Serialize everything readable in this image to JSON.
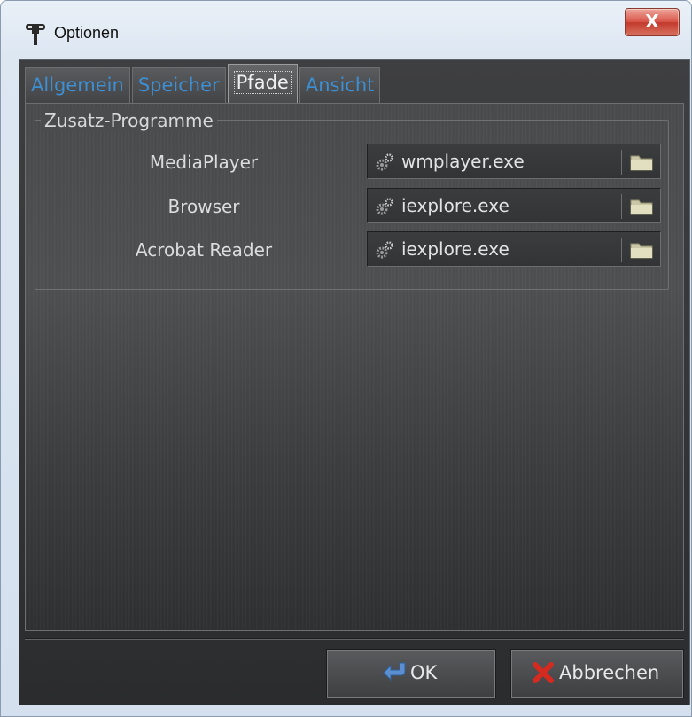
{
  "window": {
    "title": "Optionen",
    "close_label": "X"
  },
  "tabs": [
    {
      "label": "Allgemein",
      "active": false
    },
    {
      "label": "Speicher",
      "active": false
    },
    {
      "label": "Pfade",
      "active": true
    },
    {
      "label": "Ansicht",
      "active": false
    }
  ],
  "group": {
    "title": "Zusatz-Programme",
    "rows": [
      {
        "label": "MediaPlayer",
        "value": "wmplayer.exe"
      },
      {
        "label": "Browser",
        "value": "iexplore.exe"
      },
      {
        "label": "Acrobat Reader",
        "value": "iexplore.exe"
      }
    ]
  },
  "buttons": {
    "ok": "OK",
    "cancel": "Abbrechen"
  },
  "colors": {
    "tab_text": "#3d8fd1",
    "panel_bg": "#3e3f41",
    "close_red": "#c33a2d"
  },
  "icons": {
    "app": "app-icon",
    "program": "gears-icon",
    "browse": "folder-icon",
    "ok": "ok-arrow-icon",
    "cancel": "red-x-icon"
  }
}
